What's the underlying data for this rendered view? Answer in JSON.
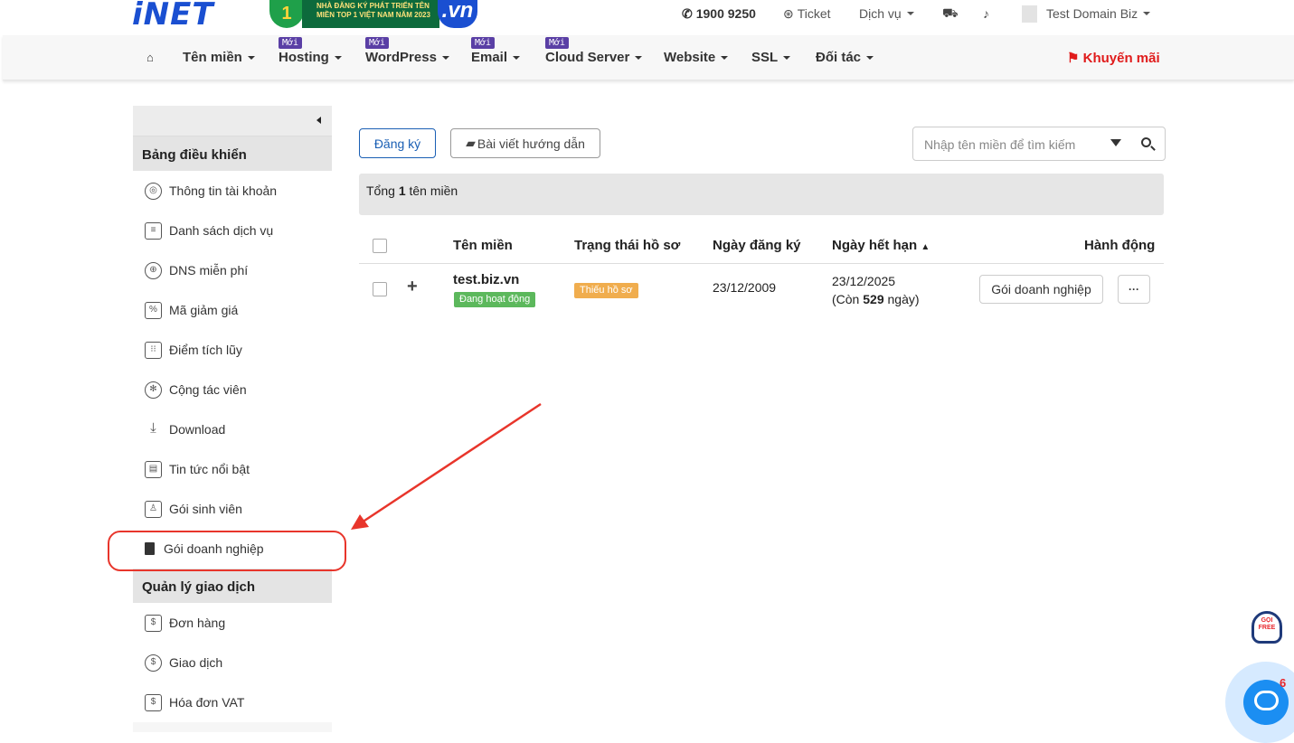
{
  "topbar": {
    "logo": "iNET",
    "award_line1": "NHÀ ĐĂNG KÝ PHÁT TRIỂN TÊN",
    "award_line2": "MIỀN TOP 1 VIỆT NAM NĂM 2023",
    "award_rank": "1",
    "award_vn": "vn",
    "phone": "1900 9250",
    "ticket": "Ticket",
    "services": "Dịch vụ",
    "user": "Test Domain Biz"
  },
  "nav": {
    "items": [
      {
        "label": "Tên miền",
        "new": false
      },
      {
        "label": "Hosting",
        "new": true
      },
      {
        "label": "WordPress",
        "new": true
      },
      {
        "label": "Email",
        "new": true
      },
      {
        "label": "Cloud Server",
        "new": true
      },
      {
        "label": "Website",
        "new": false
      },
      {
        "label": "SSL",
        "new": false
      },
      {
        "label": "Đối tác",
        "new": false
      }
    ],
    "new_tag": "Mới",
    "promo": "Khuyến mãi"
  },
  "sidebar": {
    "section1": "Bảng điều khiển",
    "items": [
      "Thông tin tài khoản",
      "Danh sách dịch vụ",
      "DNS miễn phí",
      "Mã giảm giá",
      "Điểm tích lũy",
      "Cộng tác viên",
      "Download",
      "Tin tức nổi bật",
      "Gói sinh viên",
      "Gói doanh nghiệp"
    ],
    "section2": "Quản lý giao dịch",
    "items2": [
      "Đơn hàng",
      "Giao dịch",
      "Hóa đơn VAT"
    ]
  },
  "main": {
    "register_btn": "Đăng ký",
    "guide_btn": "Bài viết hướng dẫn",
    "search_placeholder": "Nhập tên miền để tìm kiếm",
    "total_prefix": "Tổng",
    "total_count": "1",
    "total_suffix": "tên miền",
    "columns": [
      "Tên miền",
      "Trạng thái hồ sơ",
      "Ngày đăng ký",
      "Ngày hết hạn",
      "Hành động"
    ],
    "row": {
      "domain": "test.biz.vn",
      "status": "Đang hoạt động",
      "profile": "Thiếu hồ sơ",
      "registered": "23/12/2009",
      "expires": "23/12/2025",
      "remaining_prefix": "(Còn",
      "remaining_days": "529",
      "remaining_suffix": "ngày)",
      "action": "Gói doanh nghiệp",
      "more": "···"
    }
  },
  "widgets": {
    "support_text1": "GỌI",
    "support_text2": "FREE",
    "chat_count": "6"
  }
}
